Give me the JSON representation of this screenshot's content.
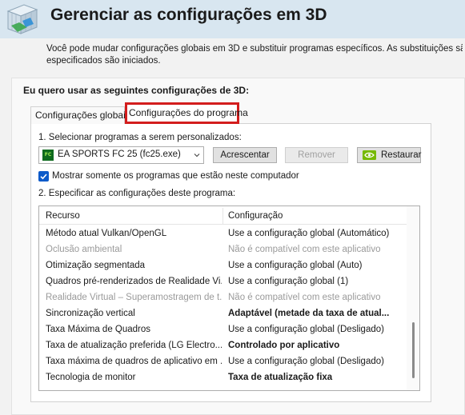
{
  "header": {
    "title": "Gerenciar as configurações em 3D",
    "logo_icon": "nvidia-3d-cube-icon",
    "description_line1": "Você pode mudar configurações globais em 3D e substituir programas específicos. As substituições são usadas",
    "description_line2": "especificados são iniciados."
  },
  "panel": {
    "section_label": "Eu quero usar as seguintes configurações de 3D:",
    "tabs": [
      {
        "label": "Configurações globais",
        "selected": false
      },
      {
        "label": "Configurações do programa",
        "selected": true
      }
    ],
    "step1_label": "1. Selecionar programas a serem personalizados:",
    "program_select": {
      "value": "EA SPORTS FC 25 (fc25.exe)",
      "icon": "ea-sports-fc-game-icon"
    },
    "buttons": {
      "add": "Acrescentar",
      "remove": "Remover",
      "restore": "Restaurar"
    },
    "show_only_checkbox": {
      "label": "Mostrar somente os programas que estão neste computador",
      "checked": true
    },
    "step2_label": "2. Especificar as configurações deste programa:",
    "settings_table": {
      "columns": [
        "Recurso",
        "Configuração"
      ],
      "rows": [
        {
          "feature": "Método atual Vulkan/OpenGL",
          "setting": "Use a configuração global (Automático)",
          "style": "normal"
        },
        {
          "feature": "Oclusão ambiental",
          "setting": "Não é compatível com este aplicativo",
          "style": "disabled"
        },
        {
          "feature": "Otimização segmentada",
          "setting": "Use a configuração global (Auto)",
          "style": "normal"
        },
        {
          "feature": "Quadros pré-renderizados de Realidade Vi...",
          "setting": "Use a configuração global (1)",
          "style": "normal"
        },
        {
          "feature": "Realidade Virtual – Superamostragem de t...",
          "setting": "Não é compatível com este aplicativo",
          "style": "disabled"
        },
        {
          "feature": "Sincronização vertical",
          "setting": "Adaptável (metade da taxa de atual...",
          "style": "bold"
        },
        {
          "feature": "Taxa Máxima de Quadros",
          "setting": "Use a configuração global (Desligado)",
          "style": "normal"
        },
        {
          "feature": "Taxa de atualização preferida (LG Electro...",
          "setting": "Controlado por aplicativo",
          "style": "bold"
        },
        {
          "feature": "Taxa máxima de quadros de aplicativo em ...",
          "setting": "Use a configuração global (Desligado)",
          "style": "normal"
        },
        {
          "feature": "Tecnologia de monitor",
          "setting": "Taxa de atualização fixa",
          "style": "bold"
        }
      ]
    }
  },
  "colors": {
    "header_bg": "#d8e6f0",
    "selected_tab_outline": "#d31d1d",
    "checkbox_accent": "#0c5ac9",
    "nvidia_green": "#76b900"
  }
}
